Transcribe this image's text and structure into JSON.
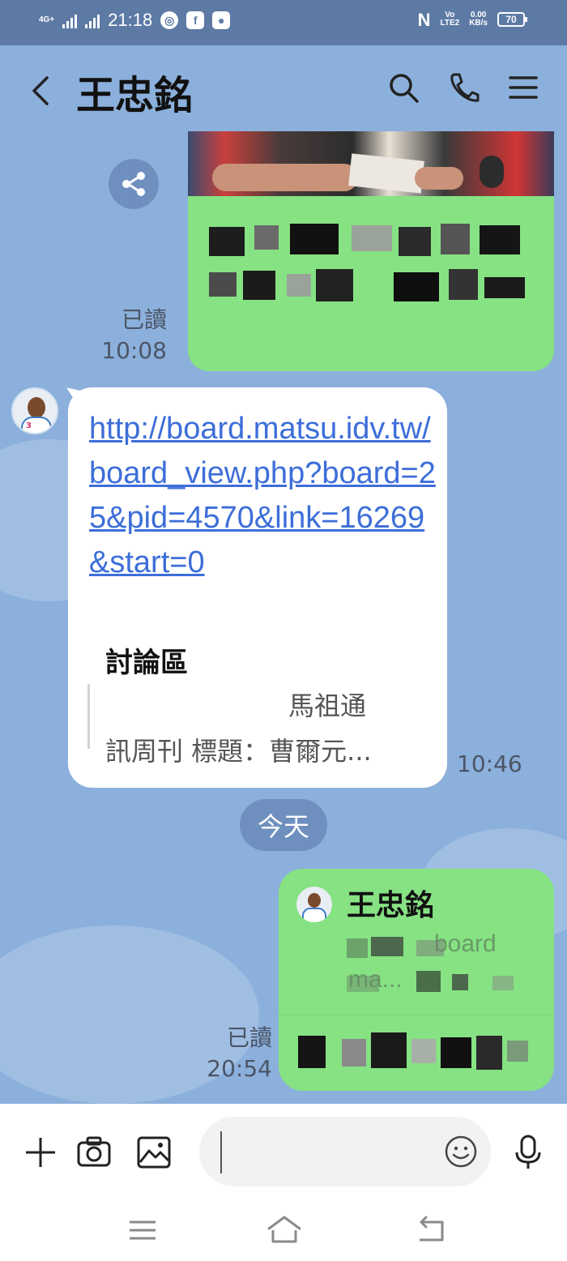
{
  "status_bar": {
    "time": "21:18",
    "network_left": "4G+",
    "volte_label": "Vo",
    "lte_label": "LTE2",
    "speed_value": "0.00",
    "speed_unit": "KB/s",
    "battery": "70"
  },
  "header": {
    "title": "王忠銘",
    "back_icon": "chevron-left-icon",
    "search_icon": "search-icon",
    "call_icon": "phone-icon",
    "menu_icon": "menu-icon"
  },
  "messages": {
    "sent_1": {
      "read_label": "已讀",
      "time": "10:08"
    },
    "received_1": {
      "link": "http://board.matsu.idv.tw/board_view.php?board=25&pid=4570&link=16269&start=0",
      "preview_title": "討論區",
      "preview_site": "馬祖通",
      "preview_desc": "訊周刊 標題：曹爾元...",
      "time": "10:46"
    },
    "date_divider": "今天",
    "sent_2": {
      "quoted_name": "王忠銘",
      "quoted_line_1": "board",
      "quoted_line_2": "ma...",
      "read_label": "已讀",
      "time": "20:54"
    }
  },
  "input_bar": {
    "plus_icon": "plus-icon",
    "camera_icon": "camera-icon",
    "image_icon": "image-icon",
    "emoji_icon": "emoji-icon",
    "mic_icon": "microphone-icon"
  },
  "nav_bar": {
    "menu_icon": "recent-apps-icon",
    "home_icon": "home-icon",
    "back_icon": "back-icon"
  },
  "colors": {
    "chat_background": "#8cb0dc",
    "status_bar": "#5d7aa5",
    "sent_bubble": "#86e283",
    "received_bubble": "#ffffff",
    "link": "#3d6ed9"
  }
}
